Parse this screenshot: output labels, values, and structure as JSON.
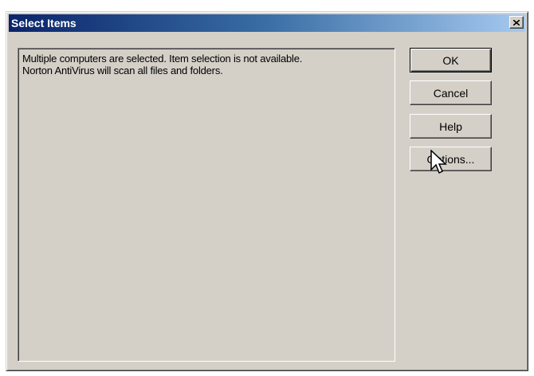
{
  "window": {
    "title": "Select Items",
    "close_icon": "close-x-icon"
  },
  "message": {
    "line1": "Multiple computers are selected. Item selection is not available.",
    "line2": "Norton AntiVirus will scan all files and folders."
  },
  "buttons": {
    "ok_label": "OK",
    "cancel_label": "Cancel",
    "help_label": "Help",
    "options_label": "Options..."
  },
  "colors": {
    "face": "#d4d0c8",
    "title_start": "#0a246a",
    "title_end": "#a6caf0"
  },
  "cursor": {
    "icon": "arrow-cursor-icon",
    "hovering": "options-button"
  }
}
